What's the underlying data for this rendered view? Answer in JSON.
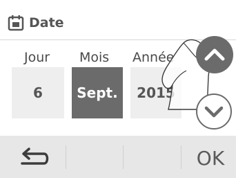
{
  "header": {
    "icon": "calendar-icon",
    "title": "Date"
  },
  "columns": [
    {
      "label": "Jour",
      "value": "6",
      "selected": false
    },
    {
      "label": "Mois",
      "value": "Sept.",
      "selected": true
    },
    {
      "label": "Année",
      "value": "2015",
      "selected": false
    }
  ],
  "controls": {
    "up_icon": "chevron-up-icon",
    "down_icon": "chevron-down-icon"
  },
  "footer": {
    "back_icon": "return-arrow-icon",
    "ok_label": "OK"
  },
  "colors": {
    "dark_gray": "#6b6b6b",
    "light_gray": "#eeeeee",
    "footer_bg": "#e7e7e7",
    "text": "#555555"
  }
}
